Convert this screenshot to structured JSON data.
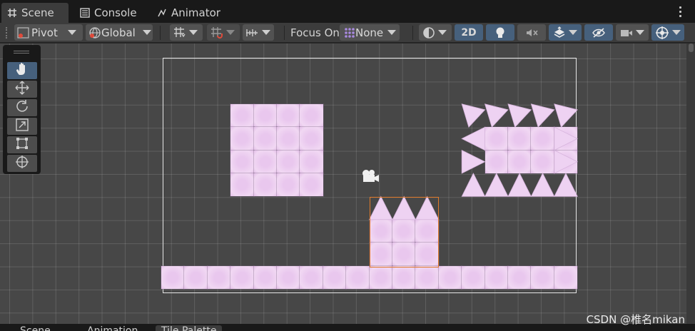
{
  "tabs": [
    {
      "label": "Scene",
      "icon": "grid-icon",
      "active": true
    },
    {
      "label": "Console",
      "icon": "console-icon",
      "active": false
    },
    {
      "label": "Animator",
      "icon": "animator-icon",
      "active": false
    }
  ],
  "toolbar": {
    "pivot": "Pivot",
    "global": "Global",
    "focus_on": "Focus On",
    "focus_value": "None",
    "mode_2d": "2D"
  },
  "tools": [
    "hand-tool",
    "move-tool",
    "rotate-tool",
    "scale-tool",
    "rect-tool",
    "transform-tool"
  ],
  "bottom_tabs": [
    "Scene",
    "Animation",
    "Tile Palette"
  ],
  "watermark": "CSDN @椎名mikan",
  "colors": {
    "tile": "#f0d4f3",
    "selection": "#e07a2a",
    "accent_blue": "#46607c",
    "scene_bg": "#474747"
  }
}
